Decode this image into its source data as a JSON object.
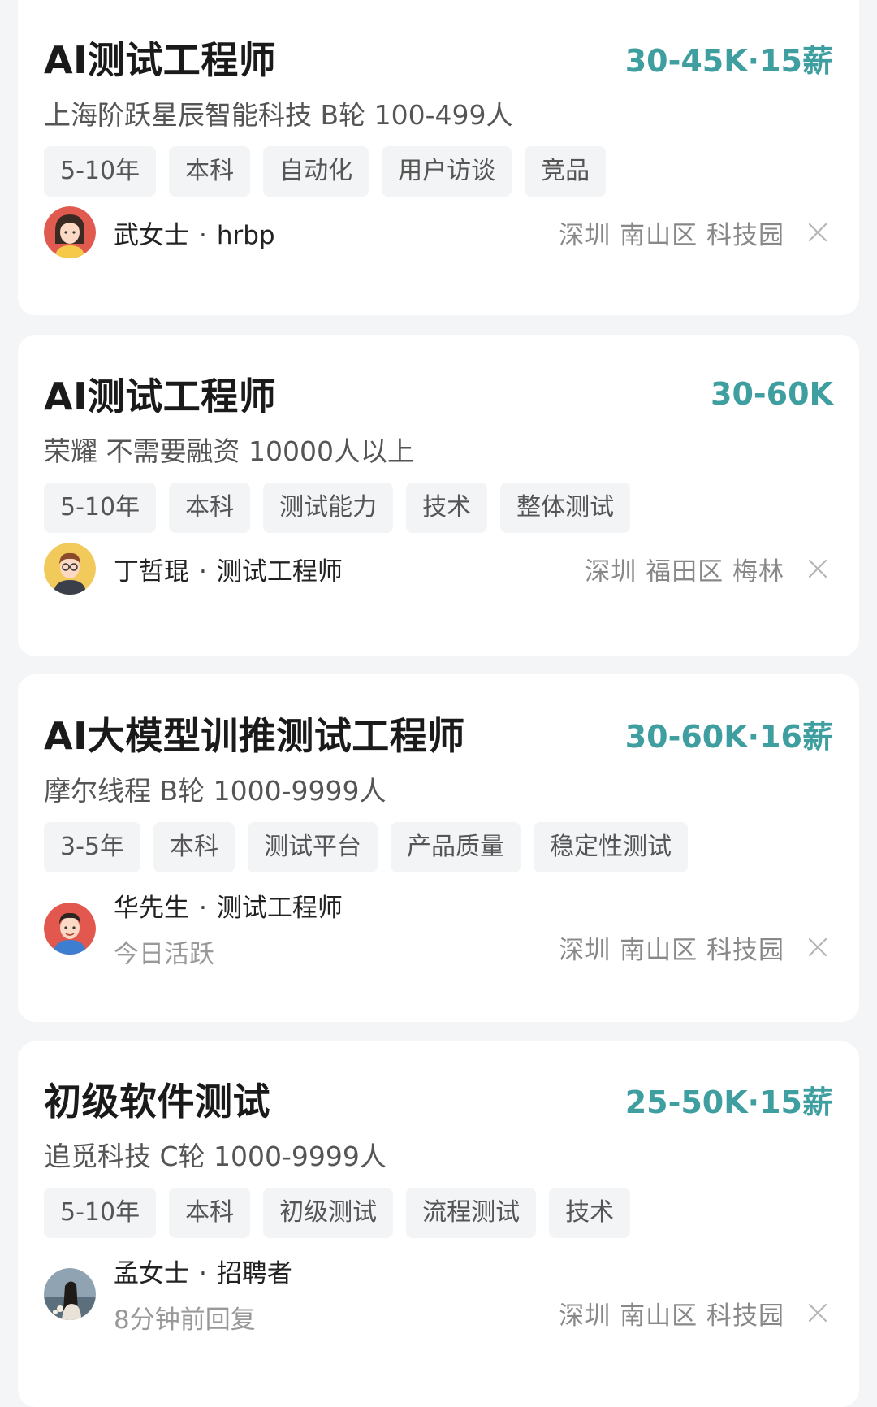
{
  "jobs": [
    {
      "title": "AI测试工程师",
      "salary": "30-45K·15薪",
      "company": "上海阶跃星辰智能科技 B轮 100-499人",
      "tags": [
        "5-10年",
        "本科",
        "自动化",
        "用户访谈",
        "竞品"
      ],
      "recruiter_name": "武女士",
      "separator": "·",
      "recruiter_role": "hrbp",
      "location": "深圳 南山区 科技园",
      "avatar_icon": "female-avatar-icon"
    },
    {
      "title": "AI测试工程师",
      "salary": "30-60K",
      "company": "荣耀 不需要融资 10000人以上",
      "tags": [
        "5-10年",
        "本科",
        "测试能力",
        "技术",
        "整体测试"
      ],
      "recruiter_name": "丁哲琨",
      "separator": "·",
      "recruiter_role": "测试工程师",
      "location": "深圳 福田区 梅林",
      "avatar_icon": "male-glasses-avatar-icon"
    },
    {
      "title": "AI大模型训推测试工程师",
      "salary": "30-60K·16薪",
      "company": "摩尔线程 B轮 1000-9999人",
      "tags": [
        "3-5年",
        "本科",
        "测试平台",
        "产品质量",
        "稳定性测试"
      ],
      "recruiter_name": "华先生",
      "separator": "·",
      "recruiter_role": "测试工程师",
      "status": "今日活跃",
      "location": "深圳 南山区 科技园",
      "avatar_icon": "male-avatar-icon"
    },
    {
      "title": "初级软件测试",
      "salary": "25-50K·15薪",
      "company": "追觅科技 C轮 1000-9999人",
      "tags": [
        "5-10年",
        "本科",
        "初级测试",
        "流程测试",
        "技术"
      ],
      "recruiter_name": "孟女士",
      "separator": "·",
      "recruiter_role": "招聘者",
      "status": "8分钟前回复",
      "location": "深圳 南山区 科技园",
      "avatar_icon": "photo-avatar-icon"
    }
  ],
  "colors": {
    "salary": "#3f9e9f",
    "background": "#f4f5f7",
    "tag_bg": "#f3f4f6"
  }
}
